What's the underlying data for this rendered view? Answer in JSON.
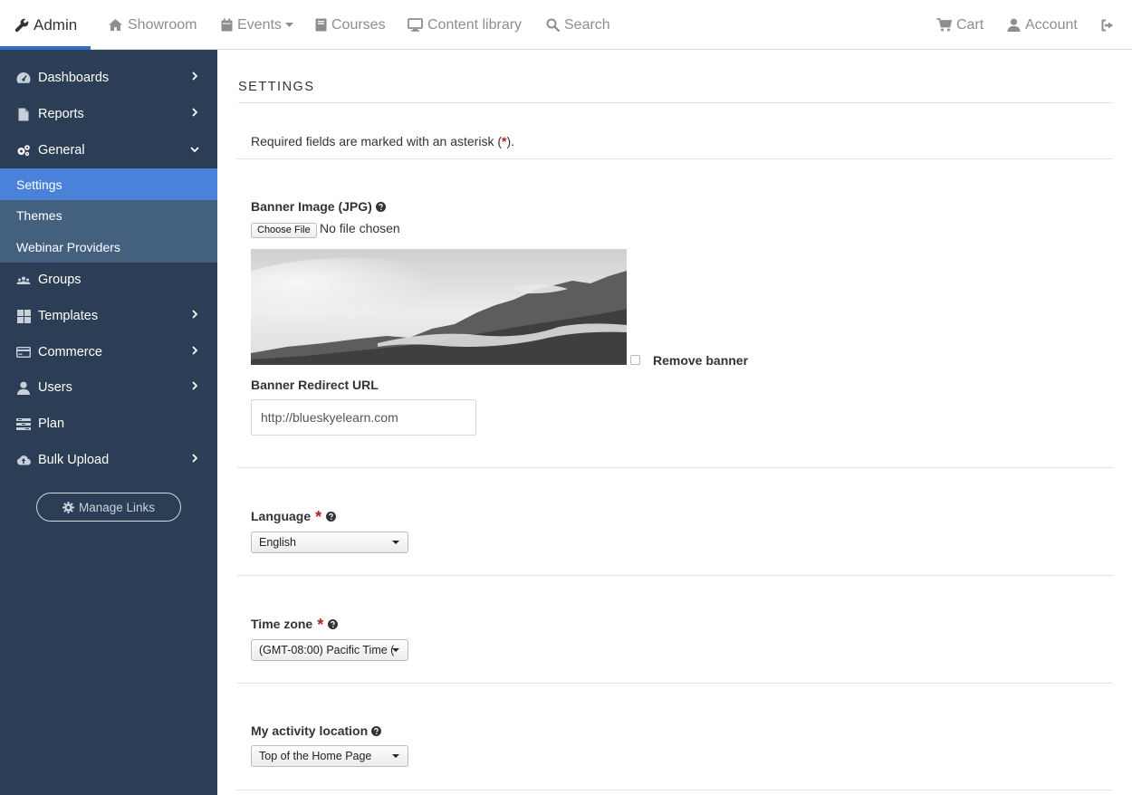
{
  "topnav": {
    "admin": "Admin",
    "showroom": "Showroom",
    "events": "Events",
    "courses": "Courses",
    "content_library": "Content library",
    "search": "Search",
    "cart": "Cart",
    "account": "Account"
  },
  "sidebar": {
    "items": [
      {
        "label": "Dashboards",
        "icon": "dashboard-icon"
      },
      {
        "label": "Reports",
        "icon": "file-icon"
      },
      {
        "label": "General",
        "icon": "gears-icon"
      },
      {
        "label": "Groups",
        "icon": "group-icon"
      },
      {
        "label": "Templates",
        "icon": "grid-icon"
      },
      {
        "label": "Commerce",
        "icon": "credit-card-icon"
      },
      {
        "label": "Users",
        "icon": "user-icon"
      },
      {
        "label": "Plan",
        "icon": "plan-icon"
      },
      {
        "label": "Bulk Upload",
        "icon": "cloud-upload-icon"
      }
    ],
    "subitems": [
      {
        "label": "Settings",
        "selected": true
      },
      {
        "label": "Themes",
        "selected": false
      },
      {
        "label": "Webinar Providers",
        "selected": false
      }
    ],
    "manage_links": "Manage Links"
  },
  "main": {
    "title": "SETTINGS",
    "required_note_pre": "Required fields are marked with an asterisk (",
    "required_note_star": "*",
    "required_note_post": ").",
    "banner": {
      "label": "Banner Image (JPG)",
      "choose_file": "Choose File",
      "file_status": "No file chosen",
      "remove_label": "Remove banner",
      "remove_checked": false
    },
    "redirect": {
      "label": "Banner Redirect URL",
      "value": "http://blueskyelearn.com"
    },
    "language": {
      "label": "Language",
      "value": "English"
    },
    "timezone": {
      "label": "Time zone",
      "value": "(GMT-08:00) Pacific Time (..."
    },
    "activity": {
      "label": "My activity location",
      "value": "Top of the Home Page"
    }
  },
  "colors": {
    "sidebar_bg": "#2c3e55",
    "sidebar_sub_bg": "#44607f",
    "selected_bg": "#4a82d9",
    "accent": "#2f6fc6",
    "required_star": "#b22222"
  }
}
